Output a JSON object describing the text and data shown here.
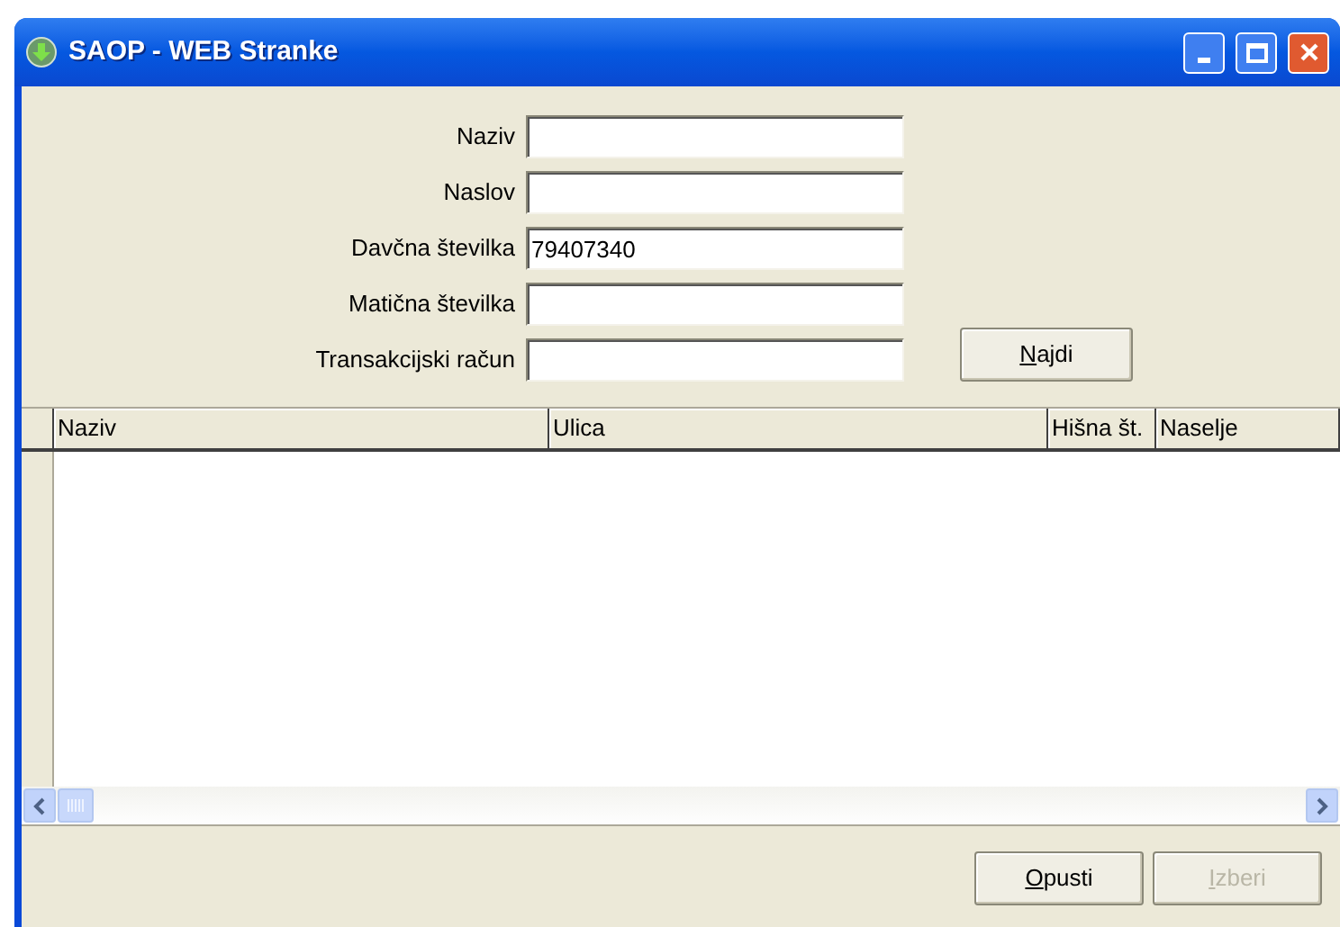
{
  "window": {
    "title": "SAOP - WEB Stranke"
  },
  "form": {
    "fields": [
      {
        "label": "Naziv"
      },
      {
        "label": "Naslov"
      },
      {
        "label": "Davčna številka",
        "value": "79407340"
      },
      {
        "label": "Matična številka"
      },
      {
        "label": "Transakcijski račun"
      }
    ],
    "search_button": {
      "label": "Najdi",
      "disabled": false
    }
  },
  "table": {
    "columns": [
      "Naziv",
      "Ulica",
      "Hišna št.",
      "Naselje"
    ]
  },
  "buttons": [
    {
      "label": "Opusti",
      "disabled": false
    },
    {
      "label": "Izberi",
      "disabled": true
    }
  ]
}
